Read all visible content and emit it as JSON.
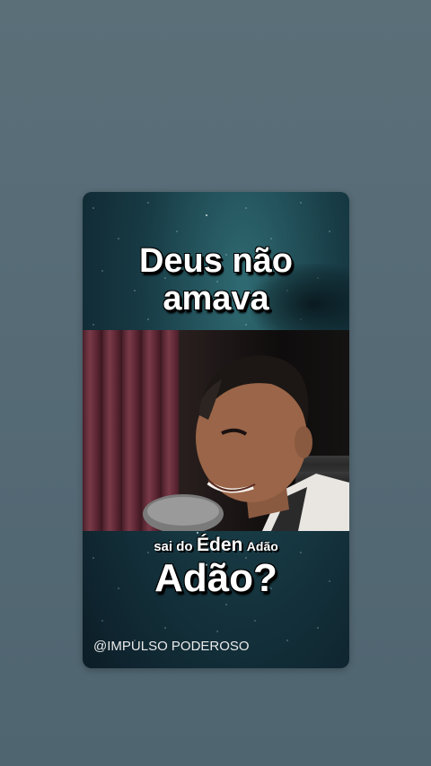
{
  "video": {
    "headline_top": "Deus não amava",
    "subtitle_words": [
      "sai do",
      "Éden",
      "Adão"
    ],
    "headline_bottom": "Adão?",
    "watermark": "@IMPULSO PODEROSO"
  },
  "colors": {
    "page_background": "#566b76",
    "text": "#ffffff",
    "text_outline": "#000000"
  }
}
